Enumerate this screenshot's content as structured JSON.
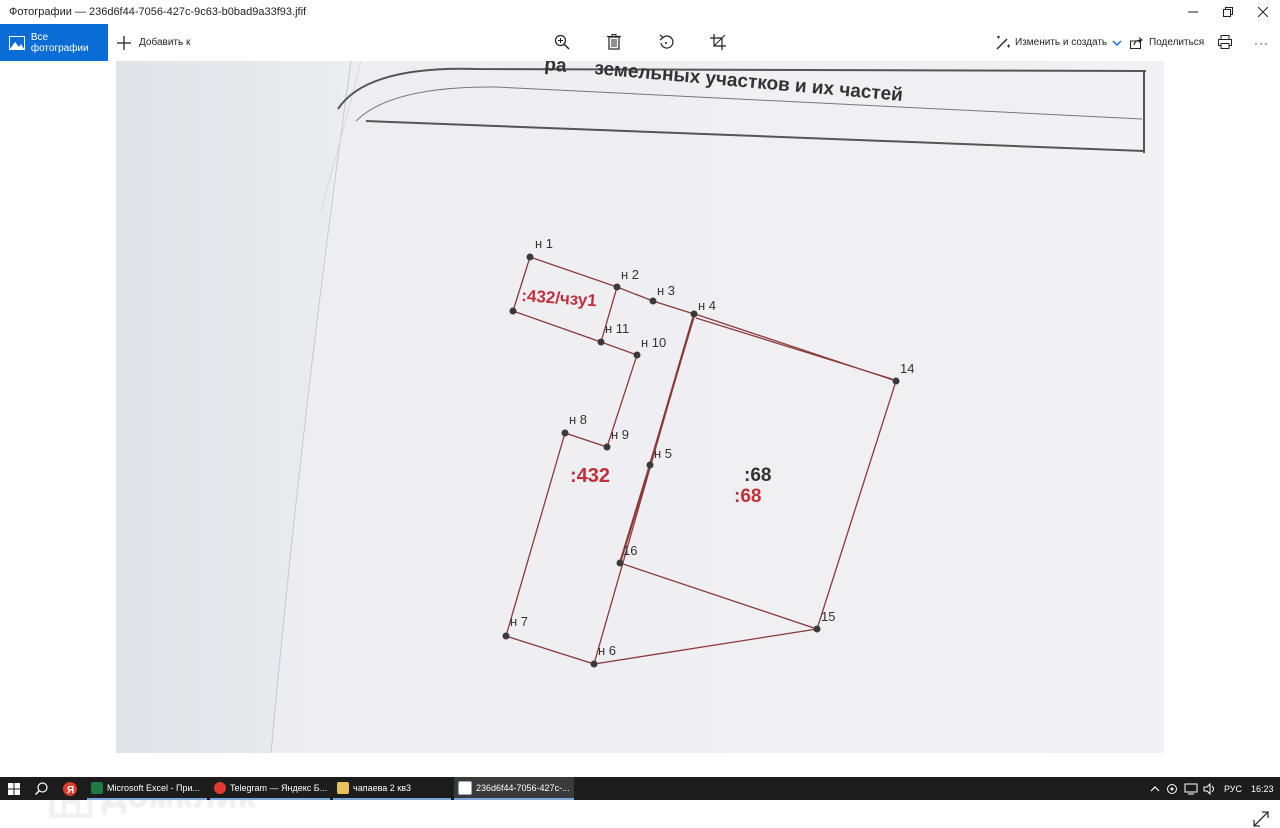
{
  "window": {
    "title": "Фотографии — 236d6f44-7056-427c-9c63-b0bad9a33f93.jfif"
  },
  "toolbar": {
    "all_photos_label": "Все фотографии",
    "add_to_label": "Добавить к",
    "edit_create_label": "Изменить и создать",
    "share_label": "Поделиться",
    "more_label": "···"
  },
  "photo": {
    "header_text": "земельных участков и их частей",
    "header_fragment": "ра",
    "points": {
      "n1": "н 1",
      "n2": "н 2",
      "n3": "н 3",
      "n4": "н 4",
      "n5": "н 5",
      "n6": "н 6",
      "n7": "н 7",
      "n8": "н 8",
      "n9": "н 9",
      "n10": "н 10",
      "n11": "н 11",
      "p14": "14",
      "p15": "15",
      "p16": "16"
    },
    "parcels": {
      "chzu": ":432/чзу1",
      "p432": ":432",
      "p68_black": ":68",
      "p68_red": ":68"
    },
    "colors": {
      "boundary": "#8a3a3a",
      "parcel_red": "#c0303a",
      "paper": "#eeeff3"
    }
  },
  "watermark": {
    "text": "Домклик"
  },
  "taskbar": {
    "tasks": [
      {
        "label": "Microsoft Excel - При..."
      },
      {
        "label": "Telegram — Яндекс Б..."
      },
      {
        "label": "чапаева 2 кв3"
      },
      {
        "label": "236d6f44-7056-427c-..."
      }
    ],
    "language": "РУС",
    "time": "16:23"
  }
}
